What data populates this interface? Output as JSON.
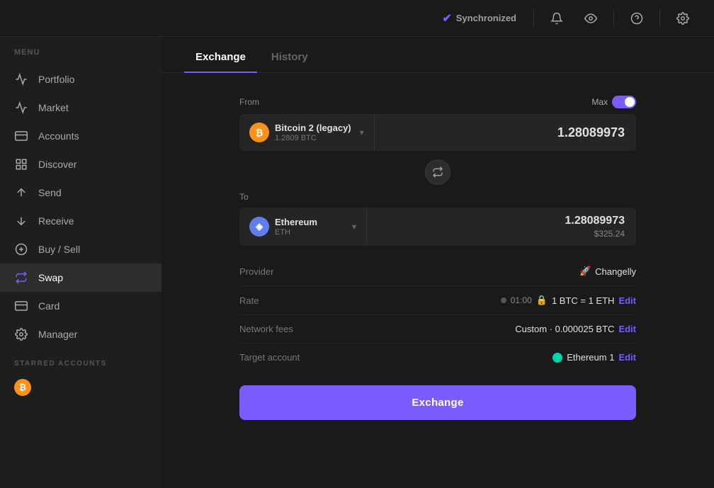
{
  "topbar": {
    "sync_label": "Synchronized",
    "icons": {
      "bell": "🔔",
      "eye": "👁",
      "question": "?",
      "gear": "⚙"
    }
  },
  "sidebar": {
    "menu_label": "MENU",
    "items": [
      {
        "id": "portfolio",
        "label": "Portfolio"
      },
      {
        "id": "market",
        "label": "Market"
      },
      {
        "id": "accounts",
        "label": "Accounts"
      },
      {
        "id": "discover",
        "label": "Discover"
      },
      {
        "id": "send",
        "label": "Send"
      },
      {
        "id": "receive",
        "label": "Receive"
      },
      {
        "id": "buysell",
        "label": "Buy / Sell"
      },
      {
        "id": "swap",
        "label": "Swap"
      },
      {
        "id": "card",
        "label": "Card"
      },
      {
        "id": "manager",
        "label": "Manager"
      }
    ],
    "starred_label": "STARRED ACCOUNTS",
    "starred_accounts": [
      {
        "id": "btc",
        "symbol": "₿",
        "color": "#f7931a"
      }
    ]
  },
  "tabs": [
    {
      "id": "exchange",
      "label": "Exchange"
    },
    {
      "id": "history",
      "label": "History"
    }
  ],
  "active_tab": "exchange",
  "exchange": {
    "from_label": "From",
    "max_label": "Max",
    "from_coin": {
      "name": "Bitcoin 2 (legacy)",
      "balance": "1.2809 BTC",
      "symbol": "₿",
      "color": "#f7931a"
    },
    "from_amount": "1.28089973",
    "swap_btn": "⇅",
    "to_label": "To",
    "to_coin": {
      "name": "Ethereum",
      "symbol": "ETH",
      "balance": "ETH",
      "color": "#627eea"
    },
    "to_amount": "1.28089973",
    "to_usd": "$325.24",
    "provider_label": "Provider",
    "provider_name": "Changelly",
    "provider_icon": "🚀",
    "rate_label": "Rate",
    "rate_time": "01:00",
    "rate_value": "1 BTC = 1 ETH",
    "rate_edit": "Edit",
    "fees_label": "Network fees",
    "fees_value": "Custom · 0.000025 BTC",
    "fees_edit": "Edit",
    "target_label": "Target account",
    "target_value": "Ethereum 1",
    "target_edit": "Edit",
    "btn_label": "Exchange"
  }
}
